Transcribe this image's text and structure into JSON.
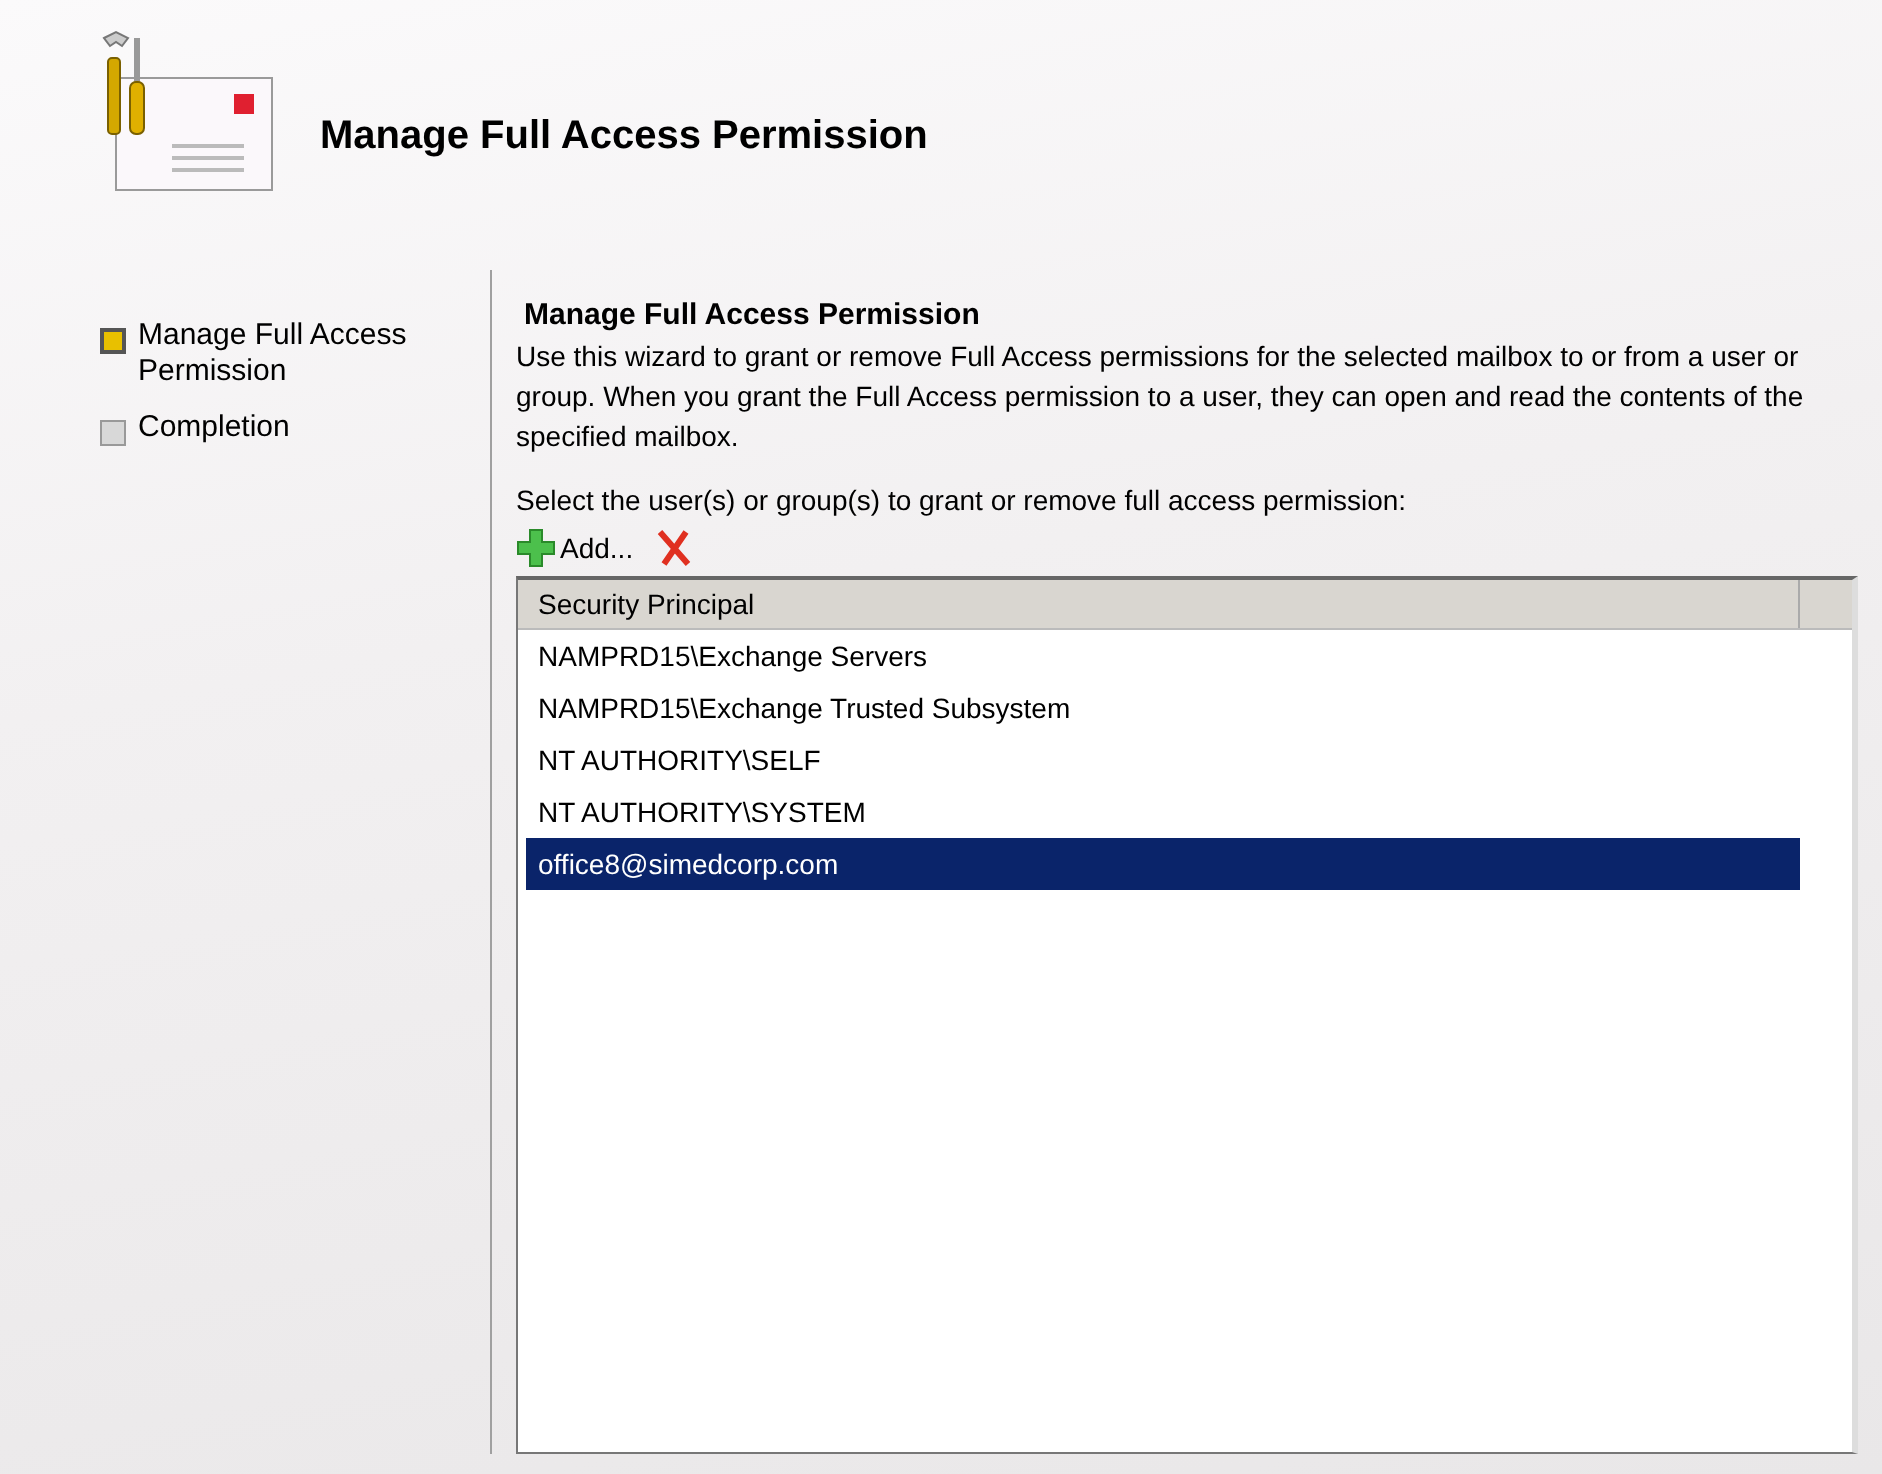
{
  "header": {
    "title": "Manage Full Access Permission"
  },
  "steps": [
    {
      "label": "Manage Full Access Permission",
      "selected": true
    },
    {
      "label": "Completion",
      "selected": false
    }
  ],
  "page": {
    "heading": "Manage Full Access Permission",
    "description": "Use this wizard to grant or remove Full Access permissions for the selected mailbox to or from a user or group. When you grant the Full Access permission to a user, they can open and read the contents of the specified mailbox.",
    "prompt": "Select the user(s) or group(s) to grant or remove full access permission:",
    "add_button": "Add..."
  },
  "table": {
    "columns": [
      "Security Principal"
    ],
    "rows": [
      {
        "name": "NAMPRD15\\Exchange Servers",
        "selected": false
      },
      {
        "name": "NAMPRD15\\Exchange Trusted Subsystem",
        "selected": false
      },
      {
        "name": "NT AUTHORITY\\SELF",
        "selected": false
      },
      {
        "name": "NT AUTHORITY\\SYSTEM",
        "selected": false
      },
      {
        "name": "office8@simedcorp.com",
        "selected": true
      }
    ]
  }
}
